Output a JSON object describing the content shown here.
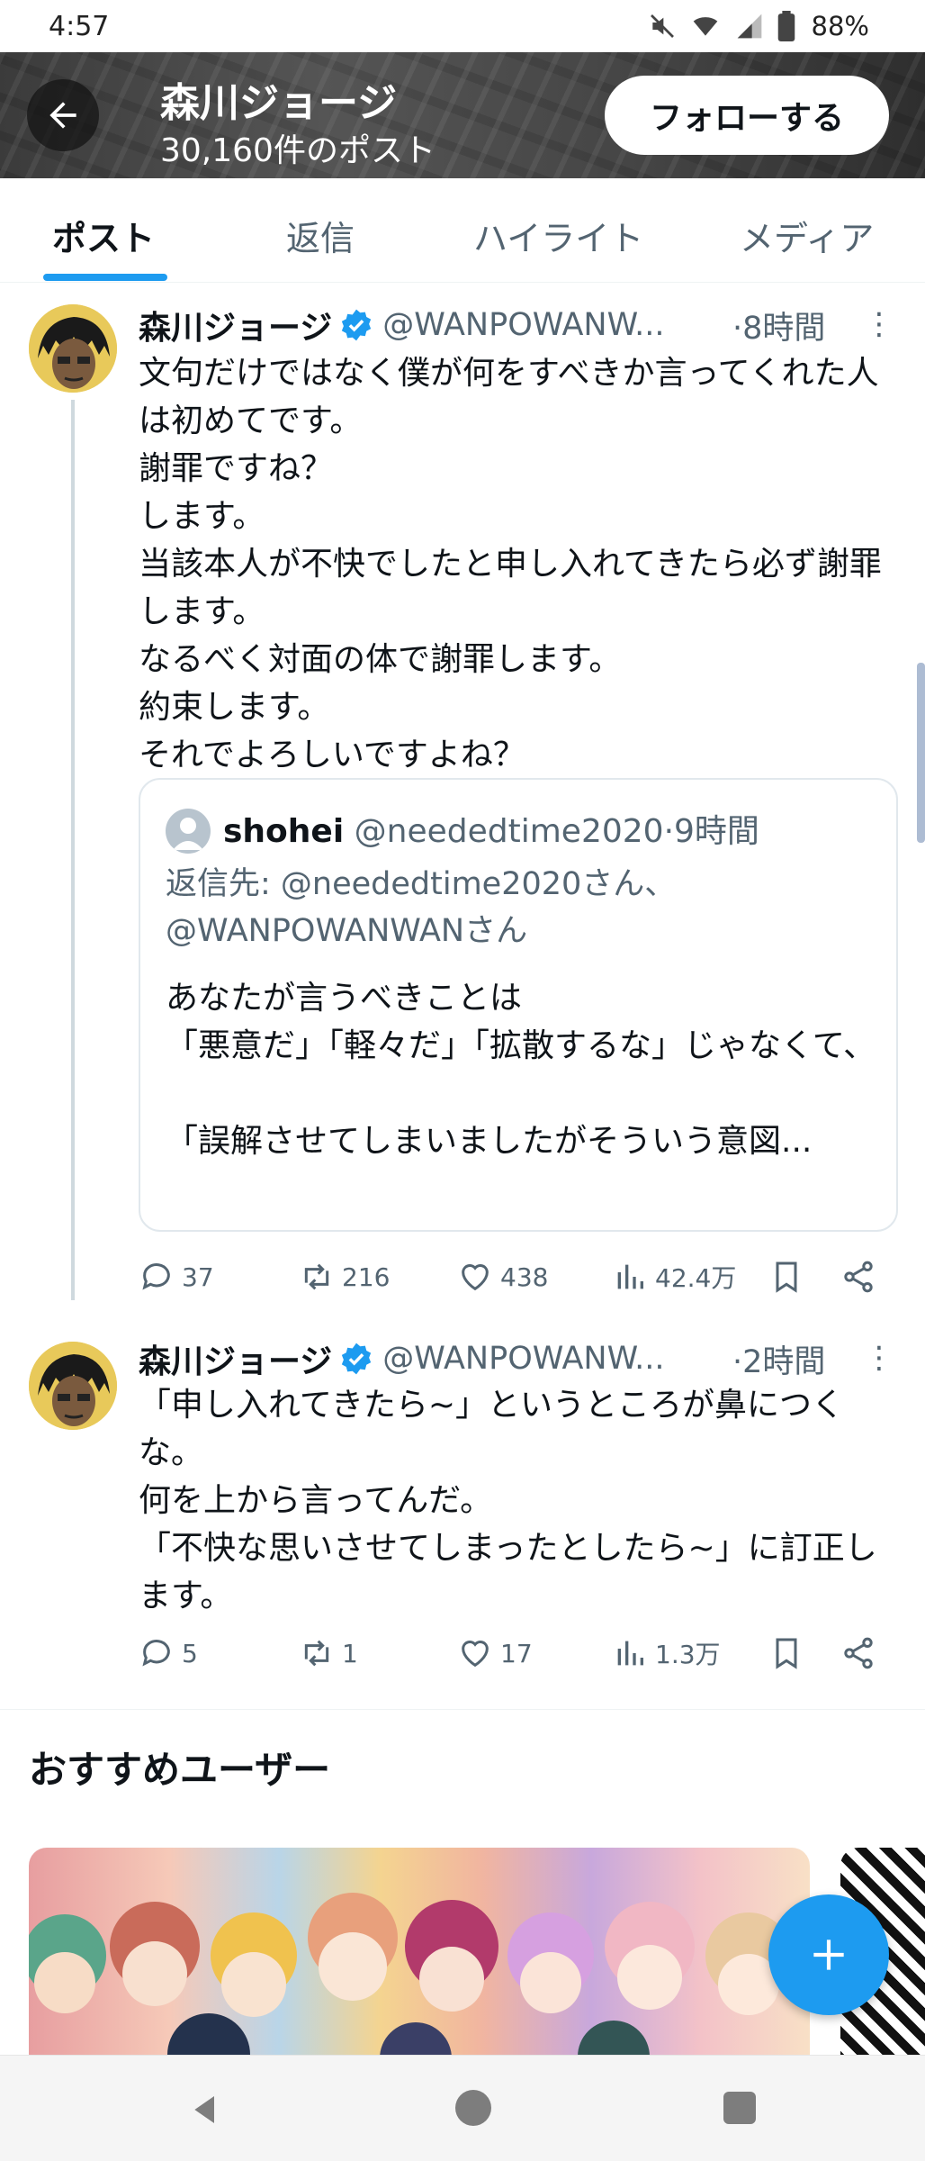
{
  "status_bar": {
    "time": "4:57",
    "battery": "88%",
    "icons": [
      "mute-icon",
      "wifi-icon",
      "signal-icon",
      "battery-icon"
    ]
  },
  "header": {
    "name": "森川ジョージ",
    "post_count": "30,160件のポスト",
    "follow_label": "フォローする"
  },
  "tabs": [
    {
      "label": "ポスト",
      "active": true
    },
    {
      "label": "返信",
      "active": false
    },
    {
      "label": "ハイライト",
      "active": false
    },
    {
      "label": "メディア",
      "active": false
    }
  ],
  "tweets": [
    {
      "name": "森川ジョージ",
      "handle": "@WANPOWANW...",
      "time": "·8時間",
      "text": "文句だけではなく僕が何をすべきか言ってくれた人は初めてです。\n謝罪ですね？\nします。\n当該本人が不快でしたと申し入れてきたら必ず謝罪します。\nなるべく対面の体で謝罪します。\n約束します。\nそれでよろしいですよね？",
      "quote": {
        "name": "shohei",
        "handle": "@neededtime2020",
        "time": "·9時間",
        "reply_to": "返信先: @neededtime2020さん、\n@WANPOWANWANさん",
        "text": "あなたが言うべきことは\n「悪意だ」「軽々だ」「拡散するな」じゃなくて、\n\n「誤解させてしまいましたがそういう意図..."
      },
      "stats": {
        "replies": "37",
        "reposts": "216",
        "likes": "438",
        "views": "42.4万"
      }
    },
    {
      "name": "森川ジョージ",
      "handle": "@WANPOWANW...",
      "time": "·2時間",
      "text": "「申し入れてきたら~」というところが鼻につくな。\n何を上から言ってんだ。\n「不快な思いさせてしまったとしたら~」に訂正します。",
      "stats": {
        "replies": "5",
        "reposts": "1",
        "likes": "17",
        "views": "1.3万"
      }
    }
  ],
  "recommendations": {
    "title": "おすすめユーザー"
  },
  "colors": {
    "accent": "#1d9bf0",
    "text": "#0f1419",
    "muted": "#536471"
  }
}
